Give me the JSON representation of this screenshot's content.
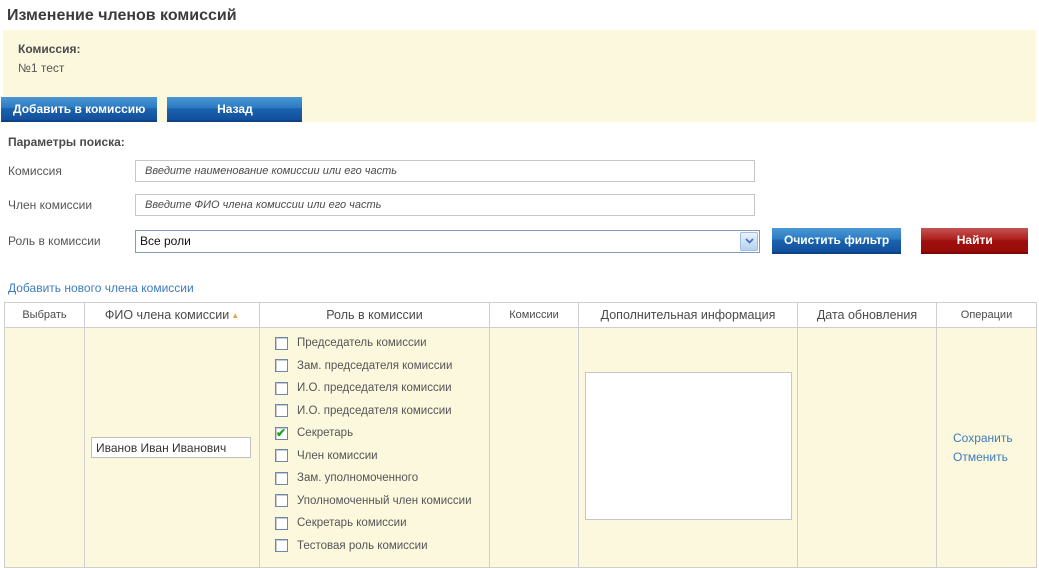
{
  "colors": {
    "panel_yellow": "#fbf8de",
    "button_blue": "#1b62ae",
    "button_red": "#9e0f0d",
    "link_blue": "#3e7bbe",
    "check_green": "#1ba51b",
    "sort_arrow_orange": "#e8a33d"
  },
  "page": {
    "title": "Изменение членов комиссий"
  },
  "commission_panel": {
    "label": "Комиссия:",
    "value": "№1 тест",
    "add_button": "Добавить в комиссию",
    "back_button": "Назад"
  },
  "search": {
    "title": "Параметры поиска:",
    "commission_field": {
      "label": "Комиссия",
      "placeholder": "Введите наименование комиссии или его часть",
      "value": ""
    },
    "member_field": {
      "label": "Член комиссии",
      "placeholder": "Введите ФИО члена комиссии или его часть",
      "value": ""
    },
    "role_field": {
      "label": "Роль в комиссии",
      "selected_option": "Все роли"
    },
    "clear_filter_button": "Очистить фильтр",
    "find_button": "Найти"
  },
  "add_new_member_link": "Добавить нового члена комиссии",
  "table": {
    "headers": [
      "Выбрать",
      "ФИО члена комиссии",
      "Роль в комиссии",
      "Комиссии",
      "Дополнительная информация",
      "Дата обновления",
      "Операции"
    ],
    "sort": {
      "column": "ФИО члена комиссии",
      "direction": "asc",
      "icon": "▲"
    },
    "row": {
      "select_value": "",
      "fio_value": "Иванов Иван Иванович",
      "roles": [
        {
          "label": "Председатель комиссии",
          "checked": false
        },
        {
          "label": "Зам. председателя комиссии",
          "checked": false
        },
        {
          "label": "И.О. председателя комиссии",
          "checked": false
        },
        {
          "label": "И.О. председателя комиссии",
          "checked": false
        },
        {
          "label": "Секретарь",
          "checked": true
        },
        {
          "label": "Член комиссии",
          "checked": false
        },
        {
          "label": "Зам. уполномоченного",
          "checked": false
        },
        {
          "label": "Уполномоченный член комиссии",
          "checked": false
        },
        {
          "label": "Секретарь комиссии",
          "checked": false
        },
        {
          "label": "Тестовая роль комиссии",
          "checked": false
        }
      ],
      "commissions_value": "",
      "additional_info_value": "",
      "update_date_value": "",
      "operations": {
        "save": "Сохранить",
        "cancel": "Отменить"
      }
    }
  }
}
